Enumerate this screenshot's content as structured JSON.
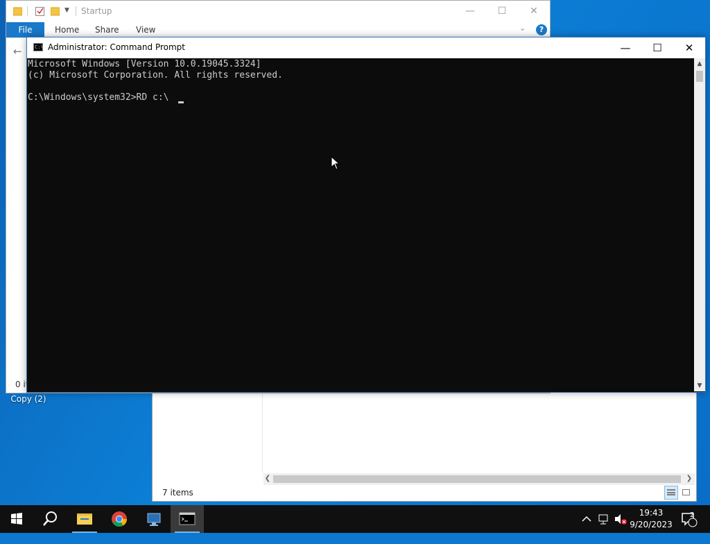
{
  "desktop": {
    "icon_label": "Copy (2)"
  },
  "explorer_front": {
    "title": "Startup",
    "ribbon_tabs": [
      "File",
      "Home",
      "Share",
      "View"
    ],
    "status": "0 it",
    "controls": {
      "minimize": "—",
      "maximize": "☐",
      "close": "✕"
    },
    "help": "?"
  },
  "explorer_back": {
    "status": "7 items"
  },
  "cmd": {
    "title": "Administrator: Command Prompt",
    "lines": [
      "Microsoft Windows [Version 10.0.19045.3324]",
      "(c) Microsoft Corporation. All rights reserved.",
      "",
      "C:\\Windows\\system32>RD c:\\ "
    ],
    "controls": {
      "minimize": "—",
      "maximize": "☐",
      "close": "✕"
    },
    "background": "#0c0c0c",
    "foreground": "#cccccc"
  },
  "taskbar": {
    "items": [
      {
        "name": "start-button",
        "icon": "windows-logo-icon"
      },
      {
        "name": "search-button",
        "icon": "search-icon"
      },
      {
        "name": "file-explorer",
        "icon": "folder-icon"
      },
      {
        "name": "chrome",
        "icon": "chrome-icon"
      },
      {
        "name": "remote-desktop",
        "icon": "monitor-icon"
      },
      {
        "name": "command-prompt",
        "icon": "terminal-icon"
      }
    ],
    "tray": {
      "chevron": "^",
      "time": "19:43",
      "date": "9/20/2023",
      "notification_count": "2"
    }
  }
}
